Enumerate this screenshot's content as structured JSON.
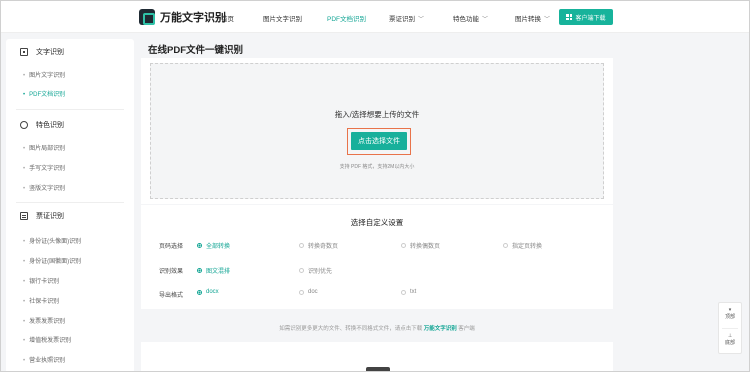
{
  "app": {
    "name": "万能文字识别"
  },
  "nav": {
    "items": [
      {
        "label": "首页",
        "has_chevron": false,
        "active": false
      },
      {
        "label": "图片文字识别",
        "has_chevron": false,
        "active": false
      },
      {
        "label": "PDF文档识别",
        "has_chevron": false,
        "active": true
      },
      {
        "label": "票证识别",
        "has_chevron": true,
        "active": false
      },
      {
        "label": "特色功能",
        "has_chevron": true,
        "active": false
      },
      {
        "label": "图片转换",
        "has_chevron": true,
        "active": false
      }
    ],
    "client_button": "客户端下载",
    "accent_color": "#17b39b"
  },
  "sidebar": {
    "groups": [
      {
        "label": "文字识别",
        "icon": "scan-icon",
        "items": [
          "图片文字识别",
          "PDF文档识别"
        ],
        "active_item": "PDF文档识别"
      },
      {
        "label": "特色识别",
        "icon": "star-icon",
        "items": [
          "图片局部识别",
          "手写文字识别",
          "竖版文字识别"
        ]
      },
      {
        "label": "票证识别",
        "icon": "card-icon",
        "items": [
          "身份证(头像面)识别",
          "身份证(国徽面)识别",
          "银行卡识别",
          "社保卡识别",
          "发票发票识别",
          "增值税发票识别",
          "营业执照识别"
        ]
      }
    ]
  },
  "main": {
    "title": "在线PDF文件一键识别",
    "upload": {
      "prompt": "拖入/选择想要上传的文件",
      "button": "点击选择文件",
      "hint": "支持 PDF 格式，支持2M以内大小"
    },
    "settings": {
      "title": "选择自定义设置",
      "rows": [
        {
          "label": "页码选择",
          "options": [
            "全部转换",
            "转换奇数页",
            "转换偶数页",
            "指定页转换"
          ],
          "selected": "全部转换"
        },
        {
          "label": "识别效果",
          "options": [
            "图文混排",
            "识别优先"
          ],
          "selected": "图文混排"
        },
        {
          "label": "导出格式",
          "options": [
            "docx",
            "doc",
            "txt"
          ],
          "selected": "docx"
        }
      ]
    },
    "footer_note": {
      "prefix": "如需识别更多更大的文件、转换不同格式文件，请点击下载",
      "link": "万能文字识别",
      "suffix": "客户端"
    }
  },
  "floating": {
    "top_label": "顶部",
    "bottom_label": "底部"
  }
}
